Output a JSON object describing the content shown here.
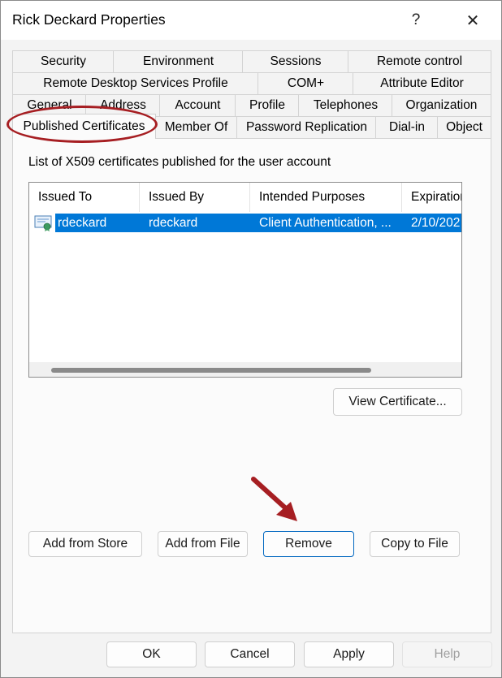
{
  "window": {
    "title": "Rick Deckard Properties",
    "help_glyph": "?",
    "close_glyph": "✕"
  },
  "tabs": {
    "row1": [
      "Security",
      "Environment",
      "Sessions",
      "Remote control"
    ],
    "row2": [
      "Remote Desktop Services Profile",
      "COM+",
      "Attribute Editor"
    ],
    "row3": [
      "General",
      "Address",
      "Account",
      "Profile",
      "Telephones",
      "Organization"
    ],
    "row4": [
      "Published Certificates",
      "Member Of",
      "Password Replication",
      "Dial-in",
      "Object"
    ],
    "active": "Published Certificates"
  },
  "panel": {
    "description": "List of X509 certificates published for the user account",
    "columns": [
      "Issued To",
      "Issued By",
      "Intended Purposes",
      "Expiration"
    ],
    "rows": [
      {
        "issued_to": "rdeckard",
        "issued_by": "rdeckard",
        "intended_purposes": "Client Authentication, ...",
        "expiration": "2/10/202",
        "selected": true
      }
    ],
    "view_certificate_label": "View Certificate...",
    "add_from_store_label": "Add from Store",
    "add_from_file_label": "Add from File",
    "remove_label": "Remove",
    "copy_to_file_label": "Copy to File"
  },
  "footer": {
    "ok_label": "OK",
    "cancel_label": "Cancel",
    "apply_label": "Apply",
    "help_label": "Help"
  },
  "colors": {
    "selection": "#0078d7",
    "annotation": "#a61e22",
    "focus_border": "#0067c0"
  }
}
